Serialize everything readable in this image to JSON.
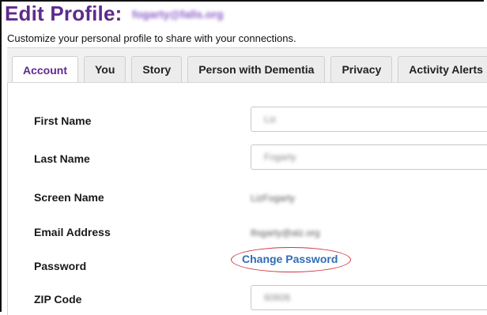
{
  "header": {
    "title": "Edit Profile:",
    "email": "fogarty@falls.org",
    "subtitle": "Customize your personal profile to share with your connections."
  },
  "tabs": [
    {
      "label": "Account",
      "active": true
    },
    {
      "label": "You",
      "active": false
    },
    {
      "label": "Story",
      "active": false
    },
    {
      "label": "Person with Dementia",
      "active": false
    },
    {
      "label": "Privacy",
      "active": false
    },
    {
      "label": "Activity Alerts",
      "active": false
    }
  ],
  "form": {
    "first_name": {
      "label": "First Name",
      "value": "Liz"
    },
    "last_name": {
      "label": "Last Name",
      "value": "Fogarty"
    },
    "screen_name": {
      "label": "Screen Name",
      "value": "LizFogarty"
    },
    "email": {
      "label": "Email Address",
      "value": "lfogarty@alz.org"
    },
    "password": {
      "label": "Password",
      "link": "Change Password"
    },
    "zip": {
      "label": "ZIP Code",
      "value": "60606"
    }
  },
  "colors": {
    "title": "#5f2a8c",
    "active_tab": "#5f2a8c",
    "link": "#2f6db5",
    "annotation": "#d0353f"
  }
}
